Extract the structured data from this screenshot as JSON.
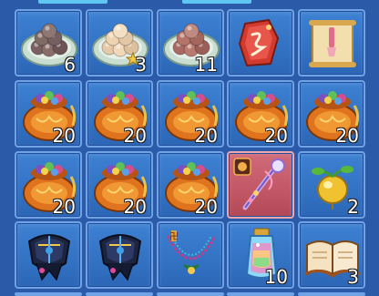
{
  "inventory": {
    "rows": [
      [
        {
          "item": "plate-of-dark-dumplings",
          "count": "6"
        },
        {
          "item": "plate-of-light-dumplings",
          "count": "3"
        },
        {
          "item": "plate-of-red-dumplings",
          "count": "11"
        },
        {
          "item": "red-rune-talisman",
          "count": ""
        },
        {
          "item": "scroll-with-brush",
          "count": ""
        }
      ],
      [
        {
          "item": "treasure-gem-bag",
          "count": "20"
        },
        {
          "item": "treasure-gem-bag",
          "count": "20"
        },
        {
          "item": "treasure-gem-bag",
          "count": "20"
        },
        {
          "item": "treasure-gem-bag",
          "count": "20"
        },
        {
          "item": "treasure-gem-bag",
          "count": "20"
        }
      ],
      [
        {
          "item": "treasure-gem-bag",
          "count": "20"
        },
        {
          "item": "treasure-gem-bag",
          "count": "20"
        },
        {
          "item": "treasure-gem-bag",
          "count": "20"
        },
        {
          "item": "crystal-staff",
          "count": "",
          "selected": true
        },
        {
          "item": "golden-fruit",
          "count": "2"
        }
      ],
      [
        {
          "item": "dark-armor-pauldron",
          "count": ""
        },
        {
          "item": "dark-armor-pauldron",
          "count": ""
        },
        {
          "item": "jade-necklace",
          "count": ""
        },
        {
          "item": "rainbow-potion-lantern",
          "count": "10"
        },
        {
          "item": "open-book",
          "count": "3"
        }
      ]
    ]
  },
  "colors": {
    "background": "#2a5aa8",
    "slot": "#3473c4",
    "slot_border": "#6fa3e6",
    "selected_slot": "#c25766",
    "selected_border": "#f0a6ae"
  }
}
